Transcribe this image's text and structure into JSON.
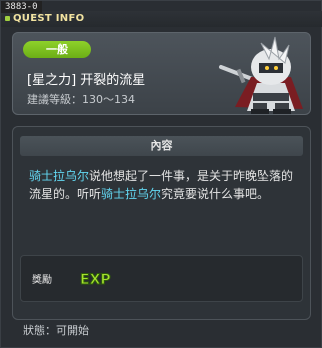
{
  "window": {
    "id_label": "3883-0",
    "title": "QUEST INFO"
  },
  "quest": {
    "category": "一般",
    "name": "[星之力] 开裂的流星",
    "level": "建議等級：130～134"
  },
  "content": {
    "header": "內容",
    "desc_npc1": "骑士拉乌尔",
    "desc_part1": "说他想起了一件事，是关于昨晚坠落的流星的。听听",
    "desc_npc2": "骑士拉乌尔",
    "desc_part2": "究竟要说什么事吧。"
  },
  "reward": {
    "label": "獎勵",
    "exp_text": "EXP"
  },
  "status": {
    "text": "狀態：可開始"
  },
  "colors": {
    "title": "#f2e3a0",
    "category_pill": "#7cc21f",
    "npc_highlight": "#62d6f0",
    "exp": "#a6e22e"
  },
  "icons": {
    "npc": "knight-npc-portrait",
    "exp": "exp-reward-icon"
  }
}
